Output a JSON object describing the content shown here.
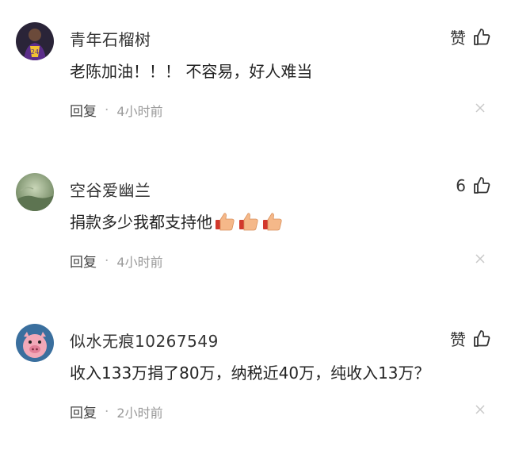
{
  "comments": [
    {
      "username": "青年石榴树",
      "like_label": "赞",
      "text": "老陈加油！！！ 不容易，好人难当",
      "reply_label": "回复",
      "separator": "·",
      "time": "4小时前",
      "avatar_icon": "avatar-purple-jersey",
      "emoji_count": 0
    },
    {
      "username": "空谷爱幽兰",
      "like_label": "6",
      "text": "捐款多少我都支持他",
      "reply_label": "回复",
      "separator": "·",
      "time": "4小时前",
      "avatar_icon": "avatar-green-landscape",
      "emoji": "thumbs-up-emoji",
      "emoji_count": 3
    },
    {
      "username": "似水无痕10267549",
      "like_label": "赞",
      "text": "收入133万捐了80万，纳税近40万，纯收入13万？",
      "reply_label": "回复",
      "separator": "·",
      "time": "2小时前",
      "avatar_icon": "avatar-pig-cartoon",
      "emoji_count": 0
    }
  ],
  "icons": {
    "like": "thumbs-up-outline-icon",
    "close": "close-icon"
  },
  "colors": {
    "text": "#222222",
    "meta": "#9a9a9a",
    "close": "#c8c8c8"
  }
}
